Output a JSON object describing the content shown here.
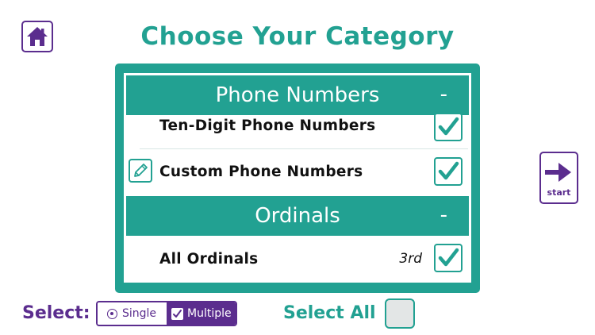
{
  "header": {
    "title": "Choose Your Category"
  },
  "icons": {
    "home": "home-icon",
    "start": "arrow-right-icon",
    "edit": "pencil-icon",
    "check": "checkmark-icon"
  },
  "colors": {
    "teal": "#22a192",
    "purple": "#5b2d8e",
    "white": "#ffffff"
  },
  "categories": [
    {
      "label": "Phone Numbers",
      "collapse": "-",
      "items": [
        {
          "name": "Ten-Digit Phone Numbers",
          "checked": true
        },
        {
          "name": "Custom Phone Numbers",
          "checked": true,
          "editable": true
        }
      ]
    },
    {
      "label": "Ordinals",
      "collapse": "-",
      "items": [
        {
          "name": "All Ordinals",
          "ordinal": "3rd",
          "checked": true
        }
      ]
    }
  ],
  "start": {
    "label": "start"
  },
  "footer": {
    "select_label": "Select:",
    "single_label": "Single",
    "multiple_label": "Multiple",
    "mode": "Multiple",
    "select_all_label": "Select All",
    "select_all_checked": false
  }
}
